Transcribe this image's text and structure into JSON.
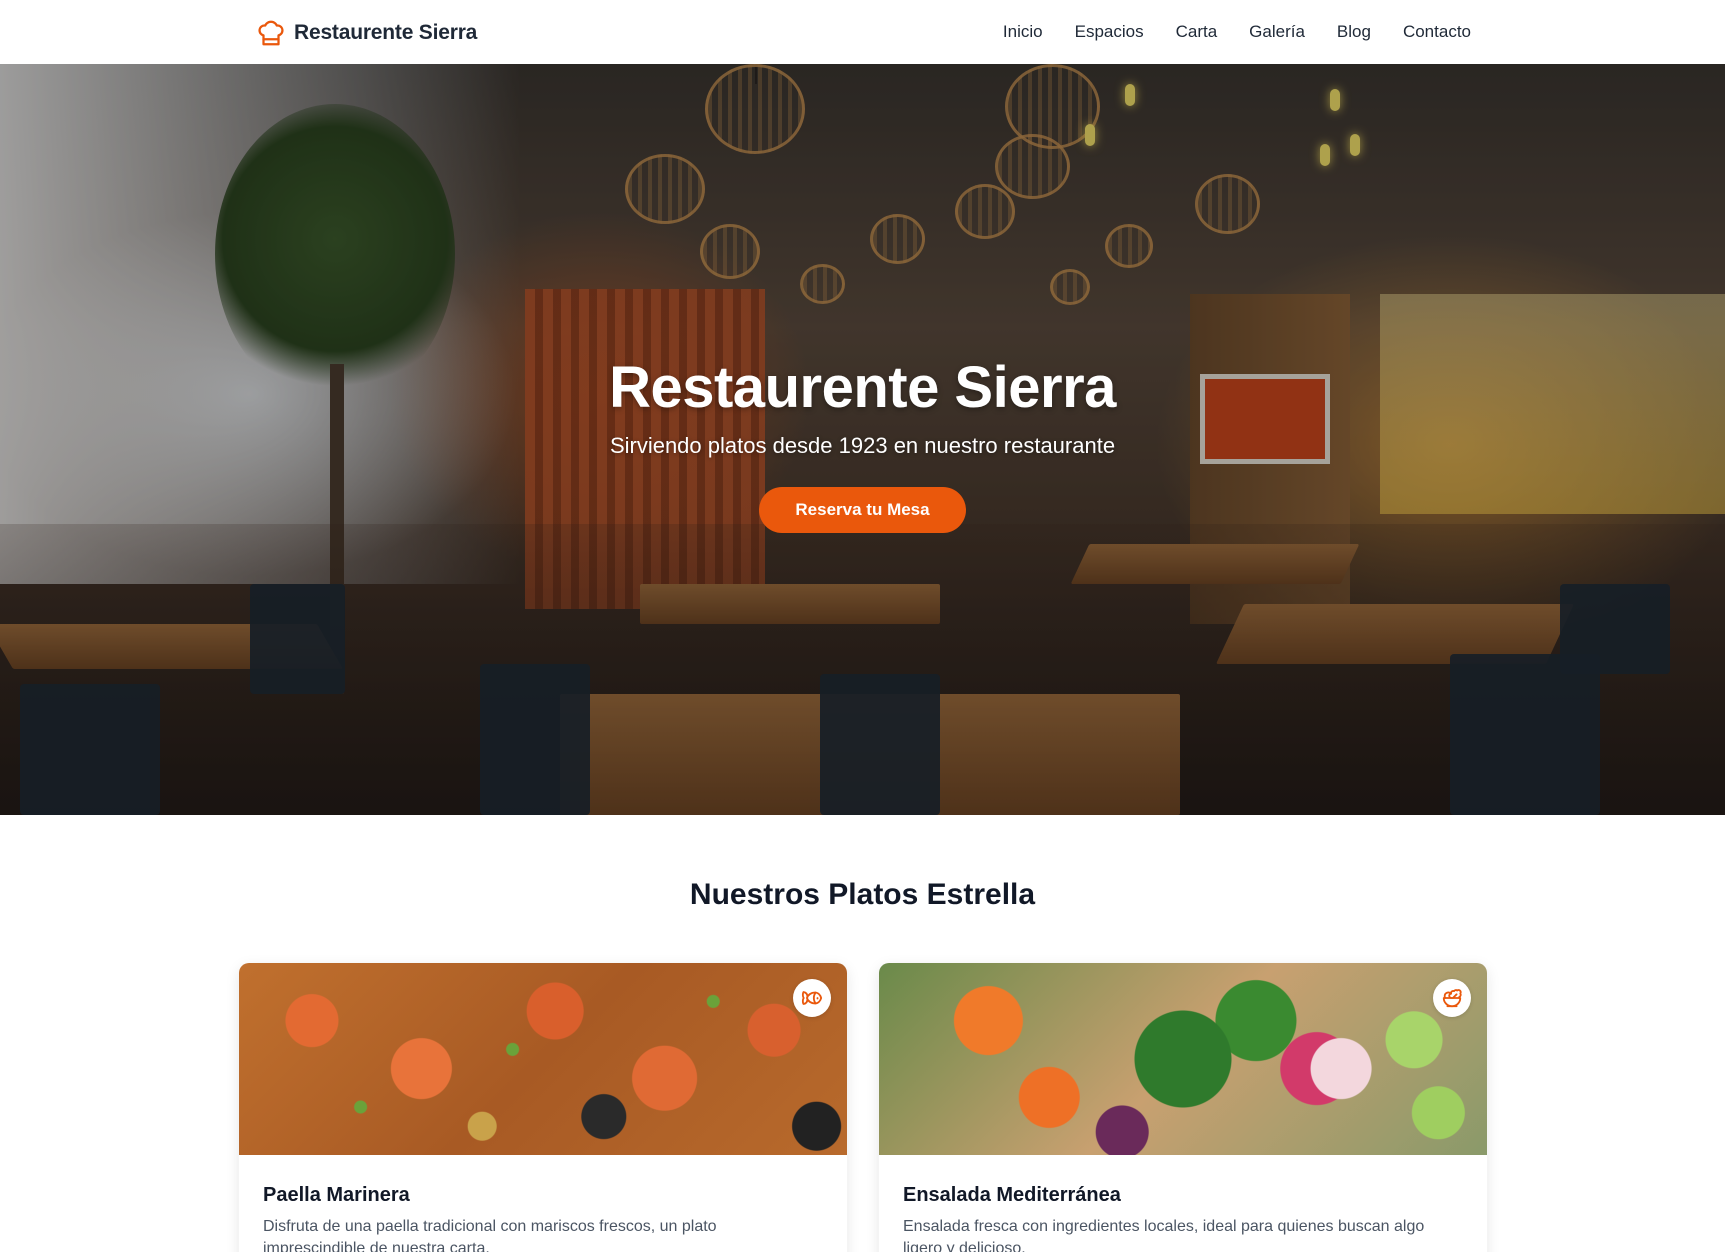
{
  "brand": {
    "name": "Restaurente Sierra",
    "icon": "chef-hat-icon",
    "accent_color": "#ea580c"
  },
  "nav": {
    "items": [
      {
        "label": "Inicio"
      },
      {
        "label": "Espacios"
      },
      {
        "label": "Carta"
      },
      {
        "label": "Galería"
      },
      {
        "label": "Blog"
      },
      {
        "label": "Contacto"
      }
    ]
  },
  "hero": {
    "title": "Restaurente Sierra",
    "subtitle": "Sirviendo platos desde 1923 en nuestro restaurante",
    "cta_label": "Reserva tu Mesa",
    "cta_color": "#ea580c"
  },
  "featured": {
    "title": "Nuestros Platos Estrella",
    "cards": [
      {
        "title": "Paella Marinera",
        "description": "Disfruta de una paella tradicional con mariscos frescos, un plato imprescindible de nuestra carta.",
        "badge_icon": "fish-icon"
      },
      {
        "title": "Ensalada Mediterránea",
        "description": "Ensalada fresca con ingredientes locales, ideal para quienes buscan algo ligero y delicioso.",
        "badge_icon": "salad-icon"
      }
    ]
  }
}
